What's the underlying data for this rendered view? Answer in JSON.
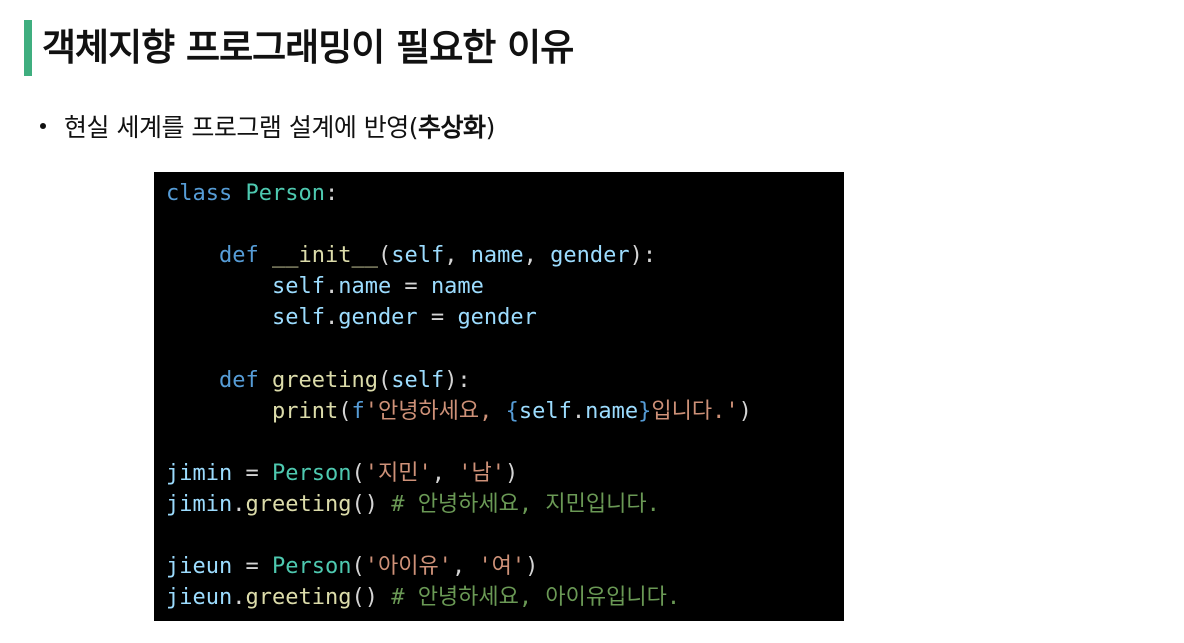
{
  "slide": {
    "title": "객체지향 프로그래밍이 필요한 이유",
    "bullet": {
      "text": "현실 세계를 프로그램 설계에 반영(",
      "emphasis": "추상화",
      "close": ")"
    }
  },
  "code": {
    "language": "python",
    "lines": [
      [
        {
          "t": "kw",
          "v": "class"
        },
        {
          "t": "pl",
          "v": " "
        },
        {
          "t": "cls",
          "v": "Person"
        },
        {
          "t": "pl",
          "v": ":"
        }
      ],
      [],
      [
        {
          "t": "pl",
          "v": "    "
        },
        {
          "t": "kw",
          "v": "def"
        },
        {
          "t": "pl",
          "v": " "
        },
        {
          "t": "fn",
          "v": "__init__"
        },
        {
          "t": "pl",
          "v": "("
        },
        {
          "t": "var",
          "v": "self"
        },
        {
          "t": "pl",
          "v": ", "
        },
        {
          "t": "var",
          "v": "name"
        },
        {
          "t": "pl",
          "v": ", "
        },
        {
          "t": "var",
          "v": "gender"
        },
        {
          "t": "pl",
          "v": "):"
        }
      ],
      [
        {
          "t": "pl",
          "v": "        "
        },
        {
          "t": "var",
          "v": "self"
        },
        {
          "t": "pl",
          "v": "."
        },
        {
          "t": "var",
          "v": "name"
        },
        {
          "t": "pl",
          "v": " = "
        },
        {
          "t": "var",
          "v": "name"
        }
      ],
      [
        {
          "t": "pl",
          "v": "        "
        },
        {
          "t": "var",
          "v": "self"
        },
        {
          "t": "pl",
          "v": "."
        },
        {
          "t": "var",
          "v": "gender"
        },
        {
          "t": "pl",
          "v": " = "
        },
        {
          "t": "var",
          "v": "gender"
        }
      ],
      [],
      [
        {
          "t": "pl",
          "v": "    "
        },
        {
          "t": "kw",
          "v": "def"
        },
        {
          "t": "pl",
          "v": " "
        },
        {
          "t": "fn",
          "v": "greeting"
        },
        {
          "t": "pl",
          "v": "("
        },
        {
          "t": "var",
          "v": "self"
        },
        {
          "t": "pl",
          "v": "):"
        }
      ],
      [
        {
          "t": "pl",
          "v": "        "
        },
        {
          "t": "fn",
          "v": "print"
        },
        {
          "t": "pl",
          "v": "("
        },
        {
          "t": "kw",
          "v": "f"
        },
        {
          "t": "str",
          "v": "'안녕하세요, "
        },
        {
          "t": "kw",
          "v": "{"
        },
        {
          "t": "var",
          "v": "self"
        },
        {
          "t": "pl",
          "v": "."
        },
        {
          "t": "var",
          "v": "name"
        },
        {
          "t": "kw",
          "v": "}"
        },
        {
          "t": "str",
          "v": "입니다.'"
        },
        {
          "t": "pl",
          "v": ")"
        }
      ],
      [],
      [
        {
          "t": "var",
          "v": "jimin"
        },
        {
          "t": "pl",
          "v": " = "
        },
        {
          "t": "cls",
          "v": "Person"
        },
        {
          "t": "pl",
          "v": "("
        },
        {
          "t": "str",
          "v": "'지민'"
        },
        {
          "t": "pl",
          "v": ", "
        },
        {
          "t": "str",
          "v": "'남'"
        },
        {
          "t": "pl",
          "v": ")"
        }
      ],
      [
        {
          "t": "var",
          "v": "jimin"
        },
        {
          "t": "pl",
          "v": "."
        },
        {
          "t": "fn",
          "v": "greeting"
        },
        {
          "t": "pl",
          "v": "() "
        },
        {
          "t": "cmt",
          "v": "# 안녕하세요, 지민입니다."
        }
      ],
      [],
      [
        {
          "t": "var",
          "v": "jieun"
        },
        {
          "t": "pl",
          "v": " = "
        },
        {
          "t": "cls",
          "v": "Person"
        },
        {
          "t": "pl",
          "v": "("
        },
        {
          "t": "str",
          "v": "'아이유'"
        },
        {
          "t": "pl",
          "v": ", "
        },
        {
          "t": "str",
          "v": "'여'"
        },
        {
          "t": "pl",
          "v": ")"
        }
      ],
      [
        {
          "t": "var",
          "v": "jieun"
        },
        {
          "t": "pl",
          "v": "."
        },
        {
          "t": "fn",
          "v": "greeting"
        },
        {
          "t": "pl",
          "v": "() "
        },
        {
          "t": "cmt",
          "v": "# 안녕하세요, 아이유입니다."
        }
      ]
    ]
  },
  "colors": {
    "accent_bar": "#3fae7f",
    "code_background": "#000000"
  }
}
